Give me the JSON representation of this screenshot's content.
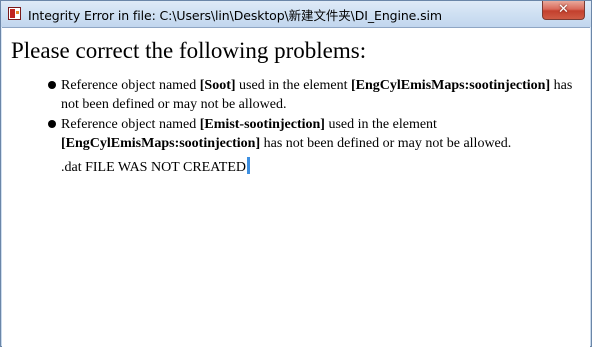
{
  "window": {
    "title": "Integrity Error in file: C:\\Users\\lin\\Desktop\\新建文件夹\\DI_Engine.sim",
    "close_label": "✕"
  },
  "content": {
    "heading": "Please correct the following problems:",
    "problems": [
      {
        "prefix": "Reference object named ",
        "object": "[Soot]",
        "middle": " used in the element ",
        "element": "[EngCylEmisMaps:sootinjection]",
        "suffix": " has not been defined or may not be allowed."
      },
      {
        "prefix": "Reference object named ",
        "object": "[Emist-sootinjection]",
        "middle": " used in the element ",
        "element": "[EngCylEmisMaps:sootinjection]",
        "suffix": " has not been defined or may not be allowed."
      }
    ],
    "footer": ".dat FILE WAS NOT CREATED"
  }
}
